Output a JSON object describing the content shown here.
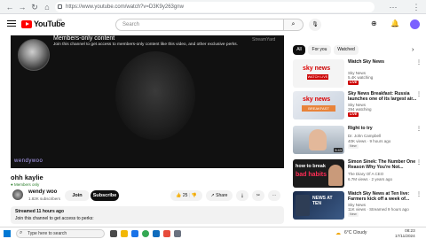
{
  "browser": {
    "url": "https://www.youtube.com/watch?v=D3K9y263gnw"
  },
  "header": {
    "logo_text": "YouTube",
    "region": "GB",
    "search_placeholder": "Search"
  },
  "player": {
    "members_title": "Members-only content",
    "members_text": "Join this channel to get access to members-only content like this video, and other exclusive perks.",
    "streamyard": "StreamYard",
    "watermark": "wendywoo"
  },
  "video": {
    "title": "ohh kaylie",
    "members_badge": "Members only",
    "channel_name": "wendy woo",
    "subscribers": "1.82K subscribers",
    "join_label": "Join",
    "subscribe_label": "Subscribe",
    "likes": "25",
    "share_label": "Share",
    "streamed": "Streamed 11 hours ago",
    "desc": "Join this channel to get access to perks:"
  },
  "chips": [
    "All",
    "For you",
    "Watched"
  ],
  "recommendations": [
    {
      "title": "Watch Sky News",
      "channel": "Sky News",
      "meta": "5.4K watching",
      "badge": "LIVE",
      "thumb": "sky1"
    },
    {
      "title": "Sky News Breakfast: Russia launches one of its largest air...",
      "channel": "Sky News",
      "meta": "294 watching",
      "badge": "LIVE",
      "thumb": "sky2"
    },
    {
      "title": "Right to try",
      "channel": "Dr. John Campbell",
      "meta": "40K views · 9 hours ago",
      "badge": "New",
      "duration": "5:43",
      "thumb": "doc"
    },
    {
      "title": "Simon Sinek: The Number One Reason Why You're Not...",
      "channel": "The Diary Of A CEO",
      "meta": "6.7M views · 2 years ago",
      "badge": "",
      "duration": "",
      "thumb": "sinek",
      "thumb_text_1": "how to break",
      "thumb_text_2": "bad habits"
    },
    {
      "title": "Watch Sky News at Ten live: Farmers kick off a week of...",
      "channel": "Sky News",
      "meta": "11K views · Streamed 9 hours ago",
      "badge": "New",
      "thumb": "sky3",
      "thumb_text": "NEWS AT TEN"
    }
  ],
  "taskbar": {
    "search_text": "Type here to search",
    "weather": "6°C  Cloudy",
    "time": "08:23",
    "date": "17/11/2024"
  },
  "colors": {
    "brand_red": "#ff0000",
    "live_red": "#cc0000",
    "sky_red": "#e40046"
  }
}
